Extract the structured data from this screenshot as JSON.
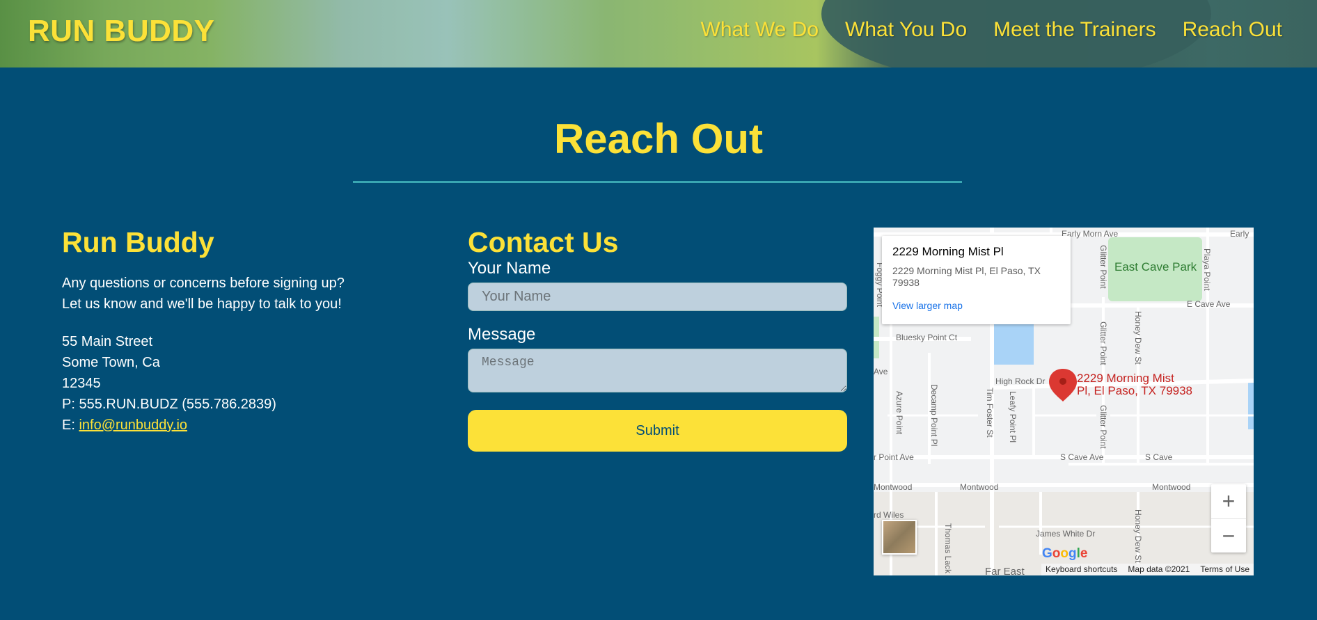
{
  "header": {
    "logo": "RUN BUDDY",
    "nav": [
      "What We Do",
      "What You Do",
      "Meet the Trainers",
      "Reach Out"
    ]
  },
  "section": {
    "title": "Reach Out"
  },
  "about": {
    "title": "Run Buddy",
    "intro_lines": [
      "Any questions or concerns before signing up?",
      "Let us know and we'll be happy to talk to you!"
    ],
    "address_lines": [
      "55 Main Street",
      "Some Town, Ca",
      "12345"
    ],
    "phone": "P: 555.RUN.BUDZ (555.786.2839)",
    "email_prefix": "E: ",
    "email": "info@runbuddy.io"
  },
  "contact": {
    "title": "Contact Us",
    "name_label": "Your Name",
    "name_placeholder": "Your Name",
    "message_label": "Message",
    "message_placeholder": "Message",
    "submit_label": "Submit"
  },
  "map": {
    "info_title": "2229 Morning Mist Pl",
    "info_address_line1": "2229 Morning Mist Pl, El Paso, TX",
    "info_address_line2": "79938",
    "view_larger": "View larger map",
    "pin_label_line1": "2229 Morning Mist",
    "pin_label_line2": "Pl, El Paso, TX 79938",
    "park": "East Cave Park",
    "streets": {
      "early_morn": "Early Morn Ave",
      "early": "Early",
      "e_cave": "E Cave Ave",
      "bluesky": "Bluesky Point Ct",
      "high_rock": "High Rock Dr",
      "s_cave": "S Cave Ave",
      "s_cave2": "S Cave",
      "point_ave": "r Point Ave",
      "montwood1": "Montwood",
      "montwood2": "Montwood",
      "montwood3": "Montwood",
      "james_white": "James White Dr",
      "wiles": "rd Wiles",
      "far_east": "Far East",
      "glitter1": "Glitter Point",
      "glitter2": "Glitter Point",
      "glitter3": "Glitter Point",
      "honey1": "Honey Dew St",
      "honey2": "Honey Dew St",
      "playa": "Playa Point",
      "azure": "Azure Point",
      "decamp": "Decamp Point Pl",
      "tim_foster": "Tim Foster St",
      "leafy": "Leafy Point Pl",
      "thomas": "Thomas Lack",
      "foggy": "Foggy Point",
      "ave": "Ave"
    },
    "zoom_in": "+",
    "zoom_out": "−",
    "google": "Google",
    "footer": [
      "Keyboard shortcuts",
      "Map data ©2021",
      "Terms of Use"
    ]
  },
  "colors": {
    "background": "#024e76",
    "accent": "#fce138",
    "divider": "#39a6b2",
    "pin": "#db3832"
  }
}
